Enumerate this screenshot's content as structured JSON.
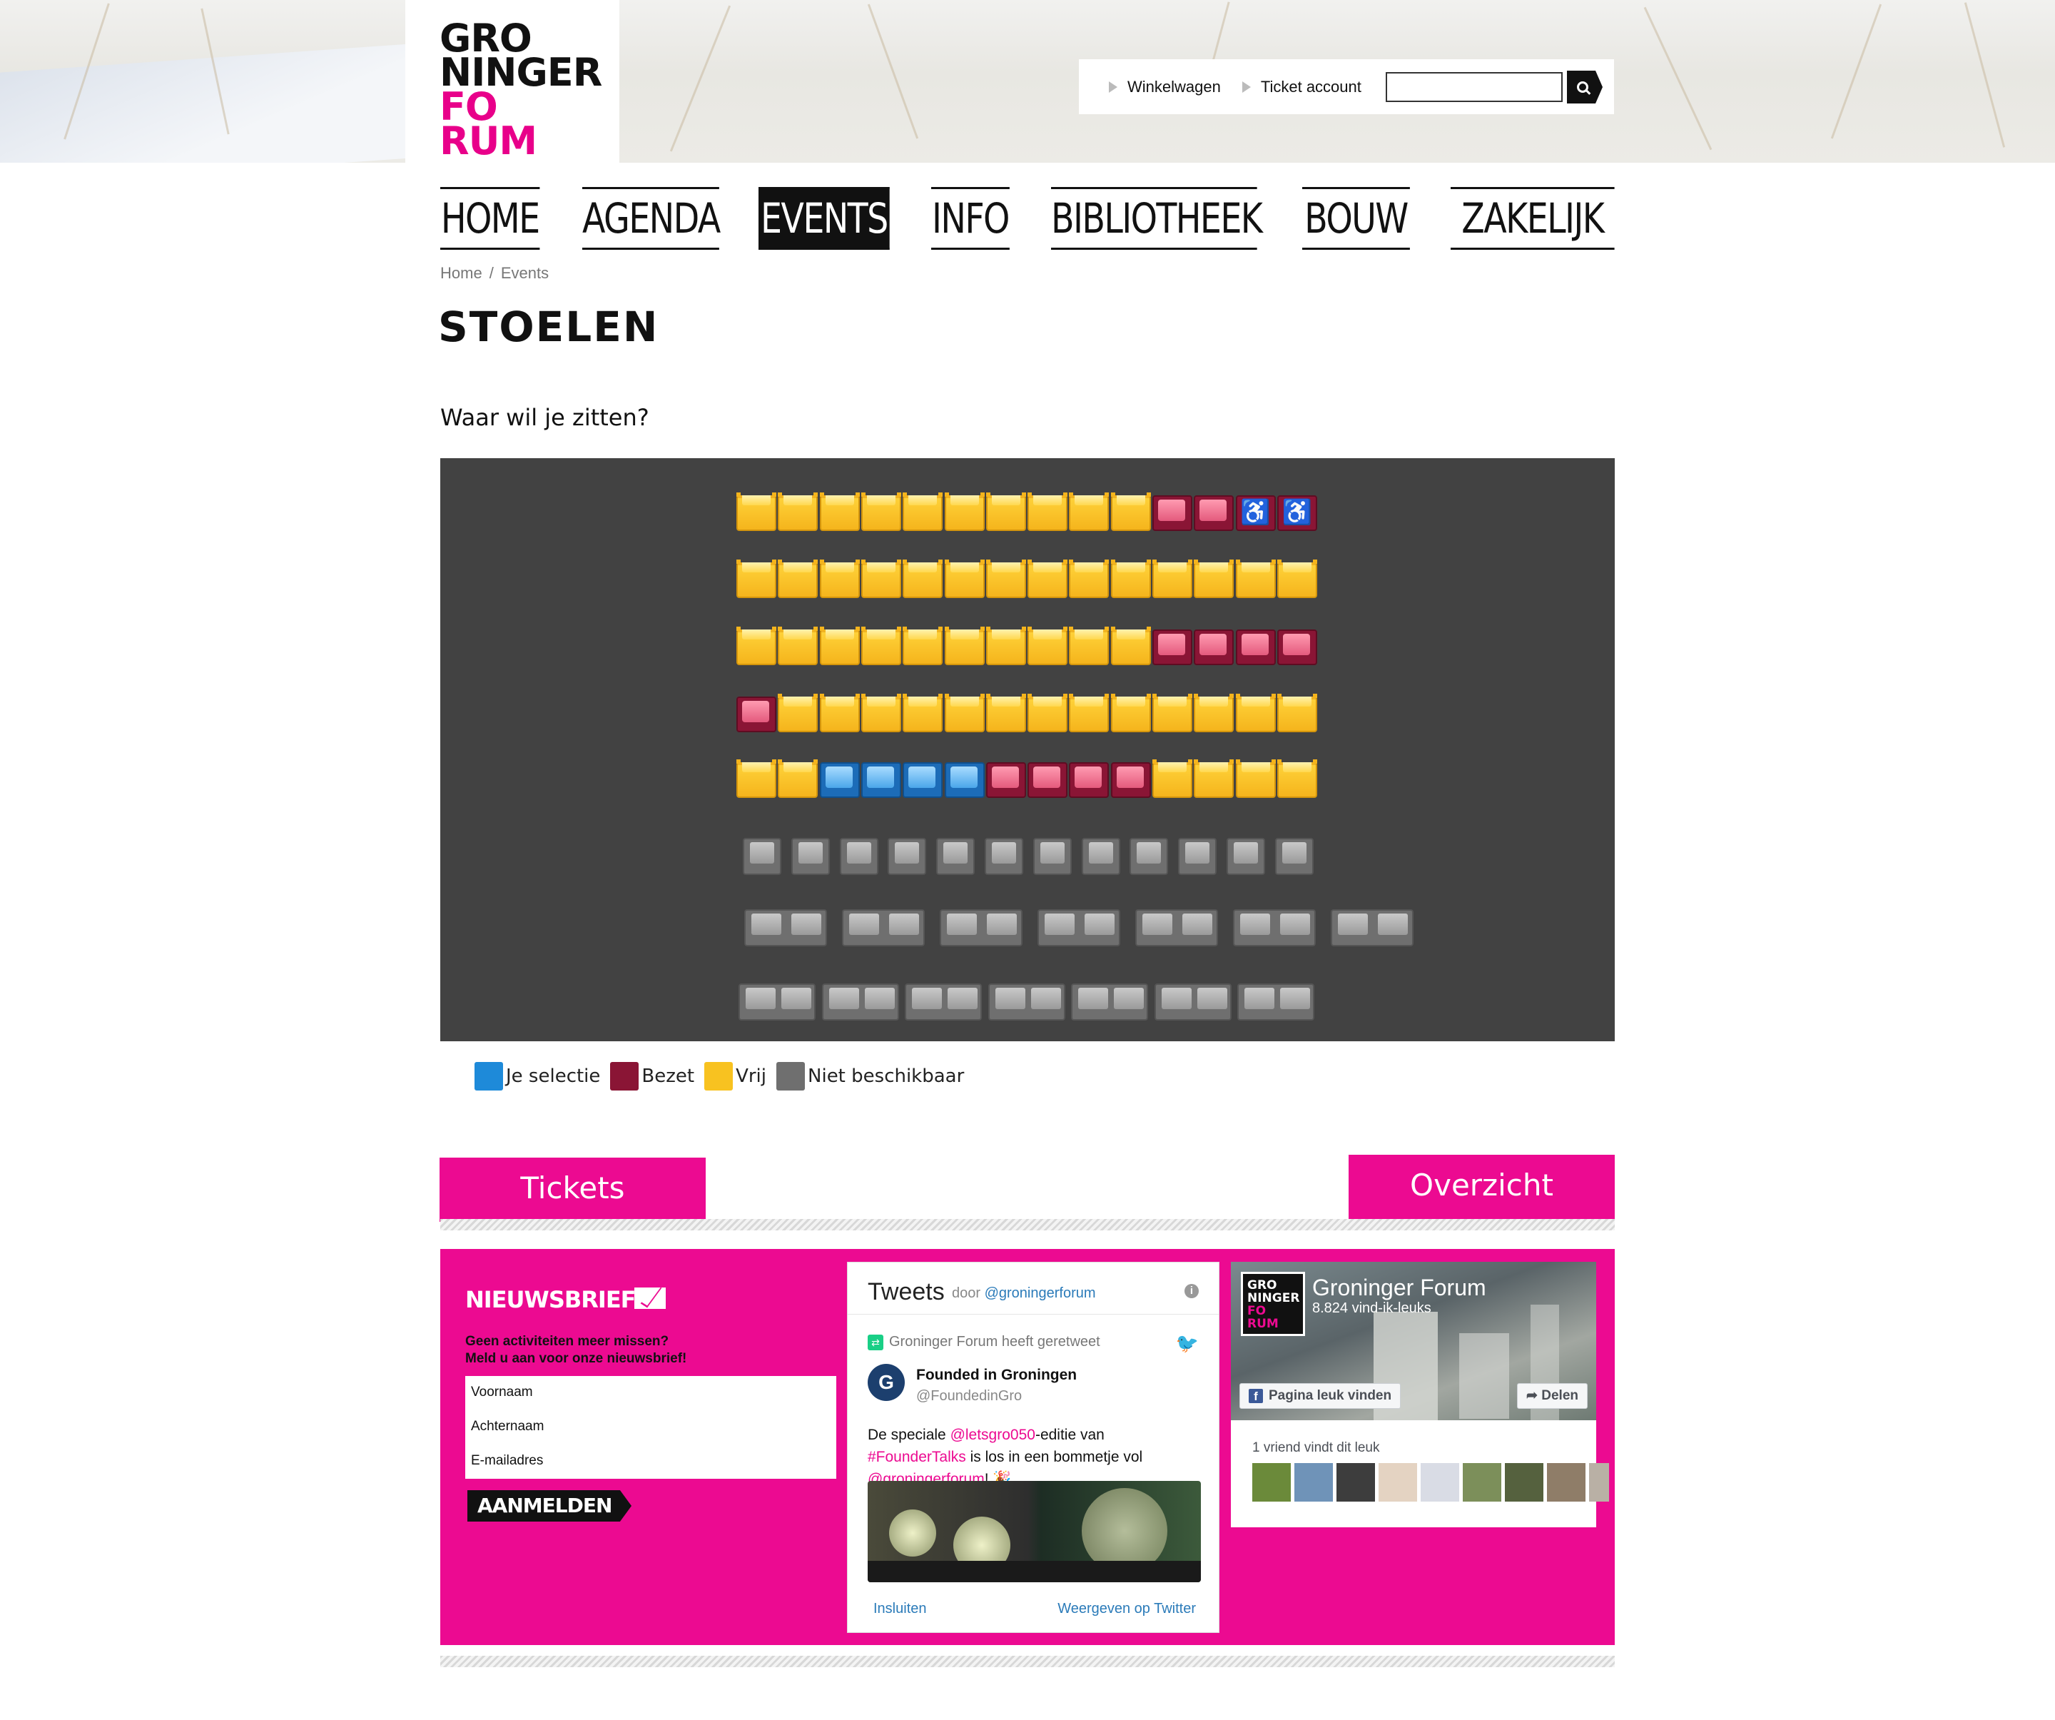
{
  "logo": {
    "line1": "GRO",
    "line2": "NINGER",
    "line3": "FO",
    "line4": "RUM"
  },
  "util": {
    "cart": "Winkelwagen",
    "account": "Ticket account"
  },
  "search": {
    "placeholder": ""
  },
  "nav": {
    "items": [
      "HOME",
      "AGENDA",
      "EVENTS",
      "INFO",
      "BIBLIOTHEEK",
      "BOUW",
      "ZAKELIJK"
    ],
    "active": "EVENTS"
  },
  "breadcrumb": {
    "home": "Home",
    "sep": "/",
    "current": "Events"
  },
  "page": {
    "title": "STOELEN",
    "question": "Waar wil je zitten?"
  },
  "seatmap": {
    "rows": [
      [
        "free",
        "free",
        "free",
        "free",
        "free",
        "free",
        "free",
        "free",
        "free",
        "free",
        "taken",
        "taken",
        "wheel",
        "wheel"
      ],
      [
        "free",
        "free",
        "free",
        "free",
        "free",
        "free",
        "free",
        "free",
        "free",
        "free",
        "free",
        "free",
        "free",
        "free"
      ],
      [
        "free",
        "free",
        "free",
        "free",
        "free",
        "free",
        "free",
        "free",
        "free",
        "free",
        "taken",
        "taken",
        "taken",
        "taken"
      ],
      [
        "taken",
        "free",
        "free",
        "free",
        "free",
        "free",
        "free",
        "free",
        "free",
        "free",
        "free",
        "free",
        "free",
        "free"
      ],
      [
        "free",
        "free",
        "selected",
        "selected",
        "selected",
        "selected",
        "taken",
        "taken",
        "taken",
        "taken",
        "free",
        "free",
        "free",
        "free"
      ]
    ],
    "unavailable_rows": [
      {
        "type": "single",
        "count": 12
      },
      {
        "type": "double",
        "count": 7
      },
      {
        "type": "triple",
        "count": 7
      }
    ],
    "wheelchair_icon": "wheelchair-icon"
  },
  "legend": [
    {
      "label": "Je selectie",
      "color": "#1e8ad9"
    },
    {
      "label": "Bezet",
      "color": "#8a1535"
    },
    {
      "label": "Vrij",
      "color": "#f8c220"
    },
    {
      "label": "Niet beschikbaar",
      "color": "#6f6f6f"
    }
  ],
  "buttons": {
    "tickets": "Tickets",
    "overview": "Overzicht"
  },
  "newsletter": {
    "title": "NIEUWSBRIEF",
    "line1": "Geen activiteiten meer missen?",
    "line2": "Meld u aan voor onze nieuwsbrief!",
    "first_name": "Voornaam",
    "last_name": "Achternaam",
    "email": "E-mailadres",
    "submit": "AANMELDEN"
  },
  "twitter": {
    "title": "Tweets",
    "by": "door",
    "handle_link": "@groningerforum",
    "retweet_note": "Groninger Forum heeft geretweet",
    "author_name": "Founded in Groningen",
    "author_handle": "@FoundedinGro",
    "text_a": "De speciale ",
    "mention1": "@letsgro050",
    "text_b": "-editie van ",
    "hashtag": "#FounderTalks",
    "text_c": " is los in een bommetje vol ",
    "mention2": "@groningerforum",
    "text_d": "! 🎉",
    "embed": "Insluiten",
    "view": "Weergeven op Twitter"
  },
  "facebook": {
    "page_name": "Groninger Forum",
    "likes": "8.824 vind-ik-leuks",
    "like_button": "Pagina leuk vinden",
    "share_button": "Delen",
    "friends": "1 vriend vindt dit leuk"
  },
  "colors": {
    "accent": "#ec0a91",
    "seat_free": "#f8c220",
    "seat_taken": "#8a1535",
    "seat_selected": "#1e8ad9",
    "seat_na": "#6f6f6f",
    "map_bg": "#424242"
  }
}
